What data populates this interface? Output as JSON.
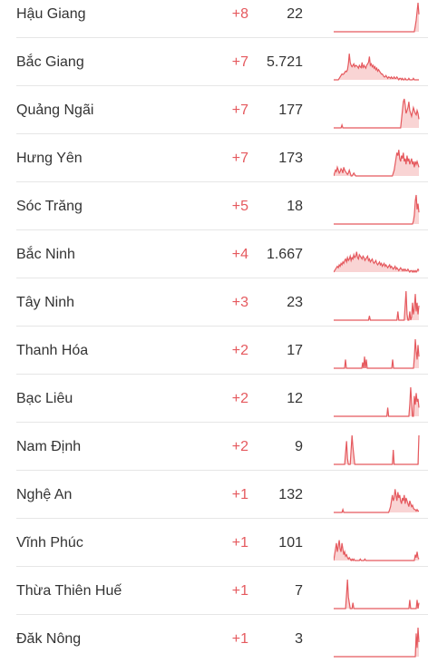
{
  "table": {
    "rows": [
      {
        "province": "Hậu Giang",
        "delta": "+8",
        "total": "22",
        "sparkline": [
          0,
          0,
          0,
          0,
          0,
          0,
          0,
          0,
          0,
          0,
          0,
          0,
          0,
          0,
          0,
          0,
          0,
          0,
          0,
          0,
          0,
          0,
          0,
          0,
          0,
          0,
          0,
          0,
          0,
          0,
          0,
          0,
          0,
          0,
          0,
          0,
          0,
          0,
          0,
          0,
          0,
          0,
          0,
          0,
          0,
          0,
          0,
          0,
          0,
          0,
          0,
          0,
          0,
          0,
          0,
          0,
          0,
          0,
          0,
          0,
          0,
          0,
          0,
          0,
          0,
          0,
          0,
          0,
          0,
          0,
          0,
          0,
          0,
          0,
          0,
          0,
          0,
          0,
          0,
          0,
          0,
          0,
          0,
          0,
          0,
          0,
          0,
          0,
          0,
          0.2,
          0.4,
          0.7,
          1,
          0.6
        ]
      },
      {
        "province": "Bắc Giang",
        "delta": "+7",
        "total": "5.721",
        "sparkline": [
          0,
          0,
          0,
          0,
          0,
          0,
          0.05,
          0.1,
          0.15,
          0.2,
          0.18,
          0.2,
          0.25,
          0.3,
          0.28,
          0.35,
          0.55,
          0.9,
          0.6,
          0.5,
          0.45,
          0.5,
          0.55,
          0.45,
          0.5,
          0.48,
          0.45,
          0.4,
          0.5,
          0.45,
          0.42,
          0.6,
          0.4,
          0.5,
          0.45,
          0.4,
          0.5,
          0.55,
          0.6,
          0.8,
          0.5,
          0.55,
          0.45,
          0.5,
          0.4,
          0.45,
          0.35,
          0.4,
          0.3,
          0.35,
          0.3,
          0.25,
          0.2,
          0.2,
          0.15,
          0.1,
          0.1,
          0.15,
          0.1,
          0.05,
          0.1,
          0.08,
          0.05,
          0.1,
          0.05,
          0.05,
          0.1,
          0.05,
          0.05,
          0.1,
          0.05,
          0,
          0.05,
          0.05,
          0,
          0.05,
          0,
          0,
          0.05,
          0,
          0,
          0,
          0.05,
          0,
          0,
          0,
          0,
          0.05,
          0,
          0,
          0,
          0,
          0,
          0
        ]
      },
      {
        "province": "Quảng Ngãi",
        "delta": "+7",
        "total": "177",
        "sparkline": [
          0,
          0,
          0,
          0,
          0,
          0,
          0,
          0,
          0,
          0.1,
          0,
          0,
          0,
          0,
          0,
          0,
          0,
          0,
          0,
          0,
          0,
          0,
          0,
          0,
          0,
          0,
          0,
          0,
          0,
          0,
          0,
          0,
          0,
          0,
          0,
          0,
          0,
          0,
          0,
          0,
          0,
          0,
          0,
          0,
          0,
          0,
          0,
          0,
          0,
          0,
          0,
          0,
          0,
          0,
          0,
          0,
          0,
          0,
          0,
          0,
          0,
          0,
          0,
          0,
          0,
          0,
          0,
          0,
          0,
          0,
          0,
          0,
          0,
          0,
          0.3,
          0.6,
          0.9,
          1,
          0.8,
          0.5,
          0.6,
          0.7,
          0.9,
          0.6,
          0.5,
          0.4,
          0.55,
          0.7,
          0.6,
          0.5,
          0.45,
          0.6,
          0.5,
          0.3
        ]
      },
      {
        "province": "Hưng Yên",
        "delta": "+7",
        "total": "173",
        "sparkline": [
          0,
          0.1,
          0.2,
          0.15,
          0.3,
          0.2,
          0.1,
          0.15,
          0.25,
          0.2,
          0.1,
          0.3,
          0.2,
          0.15,
          0.1,
          0.05,
          0.1,
          0.2,
          0.1,
          0,
          0,
          0.05,
          0.1,
          0.05,
          0,
          0,
          0,
          0,
          0,
          0,
          0,
          0,
          0,
          0,
          0,
          0,
          0,
          0,
          0,
          0,
          0,
          0,
          0,
          0,
          0,
          0,
          0,
          0,
          0,
          0,
          0,
          0,
          0,
          0,
          0,
          0,
          0,
          0,
          0,
          0,
          0,
          0,
          0,
          0,
          0,
          0.1,
          0.2,
          0.4,
          0.6,
          0.8,
          0.7,
          0.9,
          0.6,
          0.5,
          0.7,
          0.6,
          0.8,
          0.5,
          0.6,
          0.4,
          0.7,
          0.5,
          0.6,
          0.4,
          0.5,
          0.6,
          0.4,
          0.5,
          0.3,
          0.5,
          0.4,
          0.5,
          0.4,
          0.3
        ]
      },
      {
        "province": "Sóc Trăng",
        "delta": "+5",
        "total": "18",
        "sparkline": [
          0,
          0,
          0,
          0,
          0,
          0,
          0,
          0,
          0,
          0,
          0,
          0,
          0,
          0,
          0,
          0,
          0,
          0,
          0,
          0,
          0,
          0,
          0,
          0,
          0,
          0,
          0,
          0,
          0,
          0,
          0,
          0,
          0,
          0,
          0,
          0,
          0,
          0,
          0,
          0,
          0,
          0,
          0,
          0,
          0,
          0,
          0,
          0,
          0,
          0,
          0,
          0,
          0,
          0,
          0,
          0,
          0,
          0,
          0,
          0,
          0,
          0,
          0,
          0,
          0,
          0,
          0,
          0,
          0,
          0,
          0,
          0,
          0,
          0,
          0,
          0,
          0,
          0,
          0,
          0,
          0,
          0,
          0,
          0,
          0,
          0,
          0,
          0.1,
          0.3,
          0.8,
          1,
          0.5,
          0.7,
          0.4
        ]
      },
      {
        "province": "Bắc Ninh",
        "delta": "+4",
        "total": "1.667",
        "sparkline": [
          0,
          0.05,
          0.1,
          0.15,
          0.2,
          0.15,
          0.25,
          0.2,
          0.3,
          0.25,
          0.35,
          0.3,
          0.4,
          0.45,
          0.35,
          0.5,
          0.4,
          0.45,
          0.55,
          0.4,
          0.5,
          0.45,
          0.6,
          0.5,
          0.55,
          0.7,
          0.5,
          0.45,
          0.6,
          0.55,
          0.5,
          0.45,
          0.55,
          0.5,
          0.4,
          0.45,
          0.5,
          0.55,
          0.4,
          0.45,
          0.35,
          0.4,
          0.45,
          0.35,
          0.3,
          0.35,
          0.4,
          0.3,
          0.25,
          0.3,
          0.35,
          0.25,
          0.3,
          0.2,
          0.25,
          0.3,
          0.2,
          0.25,
          0.2,
          0.15,
          0.2,
          0.25,
          0.15,
          0.2,
          0.15,
          0.1,
          0.15,
          0.2,
          0.1,
          0.15,
          0.1,
          0.05,
          0.1,
          0.15,
          0.1,
          0.05,
          0.1,
          0.05,
          0.1,
          0.05,
          0.05,
          0.1,
          0.05,
          0,
          0.05,
          0.05,
          0,
          0.05,
          0,
          0.05,
          0,
          0.05,
          0.1,
          0.05
        ]
      },
      {
        "province": "Tây Ninh",
        "delta": "+3",
        "total": "23",
        "sparkline": [
          0,
          0,
          0,
          0,
          0,
          0,
          0,
          0,
          0,
          0,
          0,
          0,
          0,
          0,
          0,
          0,
          0,
          0,
          0,
          0,
          0,
          0,
          0,
          0,
          0,
          0,
          0,
          0,
          0,
          0,
          0,
          0,
          0,
          0,
          0,
          0,
          0,
          0,
          0,
          0.15,
          0,
          0,
          0,
          0,
          0,
          0,
          0,
          0,
          0,
          0,
          0,
          0,
          0,
          0,
          0,
          0,
          0,
          0,
          0,
          0,
          0,
          0,
          0,
          0,
          0,
          0,
          0,
          0,
          0,
          0,
          0.3,
          0,
          0,
          0,
          0,
          0,
          0,
          0,
          0.5,
          1,
          0.2,
          0,
          0,
          0.3,
          0,
          0.1,
          0.6,
          0.2,
          0.4,
          0.9,
          0.3,
          0.6,
          0.2,
          0.5
        ]
      },
      {
        "province": "Thanh Hóa",
        "delta": "+2",
        "total": "17",
        "sparkline": [
          0,
          0,
          0,
          0,
          0,
          0,
          0,
          0,
          0,
          0,
          0,
          0,
          0,
          0.3,
          0,
          0,
          0,
          0,
          0,
          0,
          0,
          0,
          0,
          0,
          0,
          0,
          0,
          0,
          0,
          0,
          0,
          0,
          0.2,
          0,
          0.4,
          0,
          0.3,
          0,
          0,
          0,
          0,
          0,
          0,
          0,
          0,
          0,
          0,
          0,
          0,
          0,
          0,
          0,
          0,
          0,
          0,
          0,
          0,
          0,
          0,
          0,
          0,
          0,
          0,
          0,
          0,
          0.3,
          0,
          0,
          0,
          0,
          0,
          0,
          0,
          0,
          0,
          0,
          0,
          0,
          0,
          0,
          0,
          0,
          0,
          0,
          0,
          0,
          0,
          0,
          0,
          0.4,
          1,
          0.6,
          0.3,
          0.8,
          0.4
        ]
      },
      {
        "province": "Bạc Liêu",
        "delta": "+2",
        "total": "12",
        "sparkline": [
          0,
          0,
          0,
          0,
          0,
          0,
          0,
          0,
          0,
          0,
          0,
          0,
          0,
          0,
          0,
          0,
          0,
          0,
          0,
          0,
          0,
          0,
          0,
          0,
          0,
          0,
          0,
          0,
          0,
          0,
          0,
          0,
          0,
          0,
          0,
          0,
          0,
          0,
          0,
          0,
          0,
          0,
          0,
          0,
          0,
          0,
          0,
          0,
          0,
          0,
          0,
          0,
          0,
          0,
          0,
          0,
          0,
          0,
          0,
          0.3,
          0,
          0,
          0,
          0,
          0,
          0,
          0,
          0,
          0,
          0,
          0,
          0,
          0,
          0,
          0,
          0,
          0,
          0,
          0,
          0,
          0,
          0,
          0,
          0.4,
          1,
          0.5,
          0,
          0,
          0.7,
          0.4,
          0.8,
          0.5,
          0.6,
          0.3
        ]
      },
      {
        "province": "Nam Định",
        "delta": "+2",
        "total": "9",
        "sparkline": [
          0,
          0,
          0,
          0,
          0,
          0,
          0,
          0,
          0,
          0,
          0,
          0,
          0,
          0.4,
          0.8,
          0.2,
          0,
          0,
          0,
          0.5,
          1,
          0.6,
          0.3,
          0,
          0,
          0,
          0,
          0,
          0,
          0,
          0,
          0,
          0,
          0,
          0,
          0,
          0,
          0,
          0,
          0,
          0,
          0,
          0,
          0,
          0,
          0,
          0,
          0,
          0,
          0,
          0,
          0,
          0,
          0,
          0,
          0,
          0,
          0,
          0,
          0,
          0,
          0,
          0,
          0,
          0,
          0.5,
          0,
          0,
          0,
          0,
          0,
          0,
          0,
          0,
          0,
          0,
          0,
          0,
          0,
          0,
          0,
          0,
          0,
          0,
          0,
          0,
          0,
          0,
          0,
          0,
          0,
          0,
          0,
          1
        ]
      },
      {
        "province": "Nghệ An",
        "delta": "+1",
        "total": "132",
        "sparkline": [
          0,
          0,
          0,
          0,
          0,
          0,
          0,
          0,
          0,
          0,
          0.1,
          0,
          0,
          0,
          0,
          0,
          0,
          0,
          0,
          0,
          0,
          0,
          0,
          0,
          0,
          0,
          0,
          0,
          0,
          0,
          0,
          0,
          0,
          0,
          0,
          0,
          0,
          0,
          0,
          0,
          0,
          0,
          0,
          0,
          0,
          0,
          0,
          0,
          0,
          0,
          0,
          0,
          0,
          0,
          0,
          0,
          0,
          0,
          0,
          0,
          0,
          0.1,
          0.2,
          0.4,
          0.6,
          0.4,
          0.5,
          0.8,
          0.6,
          0.4,
          0.7,
          0.5,
          0.6,
          0.4,
          0.3,
          0.5,
          0.4,
          0.6,
          0.3,
          0.5,
          0.4,
          0.3,
          0.2,
          0.4,
          0.3,
          0.2,
          0.25,
          0.15,
          0.1,
          0.1,
          0.05,
          0.1,
          0.05,
          0.05
        ]
      },
      {
        "province": "Vĩnh Phúc",
        "delta": "+1",
        "total": "101",
        "sparkline": [
          0,
          0.2,
          0.4,
          0.6,
          0.3,
          0.5,
          0.7,
          0.4,
          0.3,
          0.6,
          0.4,
          0.2,
          0.3,
          0.15,
          0.2,
          0.1,
          0.05,
          0.1,
          0.05,
          0,
          0.05,
          0,
          0.05,
          0,
          0,
          0,
          0,
          0,
          0,
          0.05,
          0,
          0,
          0,
          0,
          0.05,
          0,
          0,
          0,
          0,
          0,
          0,
          0,
          0,
          0,
          0,
          0,
          0,
          0,
          0,
          0,
          0,
          0,
          0,
          0,
          0,
          0,
          0,
          0,
          0,
          0,
          0,
          0,
          0,
          0,
          0,
          0,
          0,
          0,
          0,
          0,
          0,
          0,
          0,
          0,
          0,
          0,
          0,
          0,
          0,
          0,
          0,
          0,
          0,
          0,
          0,
          0,
          0,
          0,
          0,
          0.2,
          0.1,
          0.3,
          0.1,
          0.05
        ]
      },
      {
        "province": "Thừa Thiên Huế",
        "delta": "+1",
        "total": "7",
        "sparkline": [
          0,
          0,
          0,
          0,
          0,
          0,
          0,
          0,
          0,
          0,
          0,
          0,
          0,
          0,
          0.5,
          1,
          0.4,
          0.2,
          0,
          0,
          0,
          0.2,
          0,
          0,
          0,
          0,
          0,
          0,
          0,
          0,
          0,
          0,
          0,
          0,
          0,
          0,
          0,
          0,
          0,
          0,
          0,
          0,
          0,
          0,
          0,
          0,
          0,
          0,
          0,
          0,
          0,
          0,
          0,
          0,
          0,
          0,
          0,
          0,
          0,
          0,
          0,
          0,
          0,
          0,
          0,
          0,
          0,
          0,
          0,
          0,
          0,
          0,
          0,
          0,
          0,
          0,
          0,
          0,
          0,
          0,
          0,
          0,
          0,
          0.3,
          0,
          0,
          0,
          0,
          0,
          0,
          0,
          0.3,
          0,
          0.2
        ]
      },
      {
        "province": "Đăk Nông",
        "delta": "+1",
        "total": "3",
        "sparkline": [
          0,
          0,
          0,
          0,
          0,
          0,
          0,
          0,
          0,
          0,
          0,
          0,
          0,
          0,
          0,
          0,
          0,
          0,
          0,
          0,
          0,
          0,
          0,
          0,
          0,
          0,
          0,
          0,
          0,
          0,
          0,
          0,
          0,
          0,
          0,
          0,
          0,
          0,
          0,
          0,
          0,
          0,
          0,
          0,
          0,
          0,
          0,
          0,
          0,
          0,
          0,
          0,
          0,
          0,
          0,
          0,
          0,
          0,
          0,
          0,
          0,
          0,
          0,
          0,
          0,
          0,
          0,
          0,
          0,
          0,
          0,
          0,
          0,
          0,
          0,
          0,
          0,
          0,
          0,
          0,
          0,
          0,
          0,
          0,
          0,
          0,
          0,
          0,
          0,
          0,
          0.8,
          0.3,
          1,
          0.5
        ]
      }
    ]
  },
  "colors": {
    "delta": "#e5595e",
    "sparkline_stroke": "#e5595e",
    "sparkline_fill": "#f9d4d4",
    "divider": "#e6e6e6",
    "text": "#333333"
  }
}
